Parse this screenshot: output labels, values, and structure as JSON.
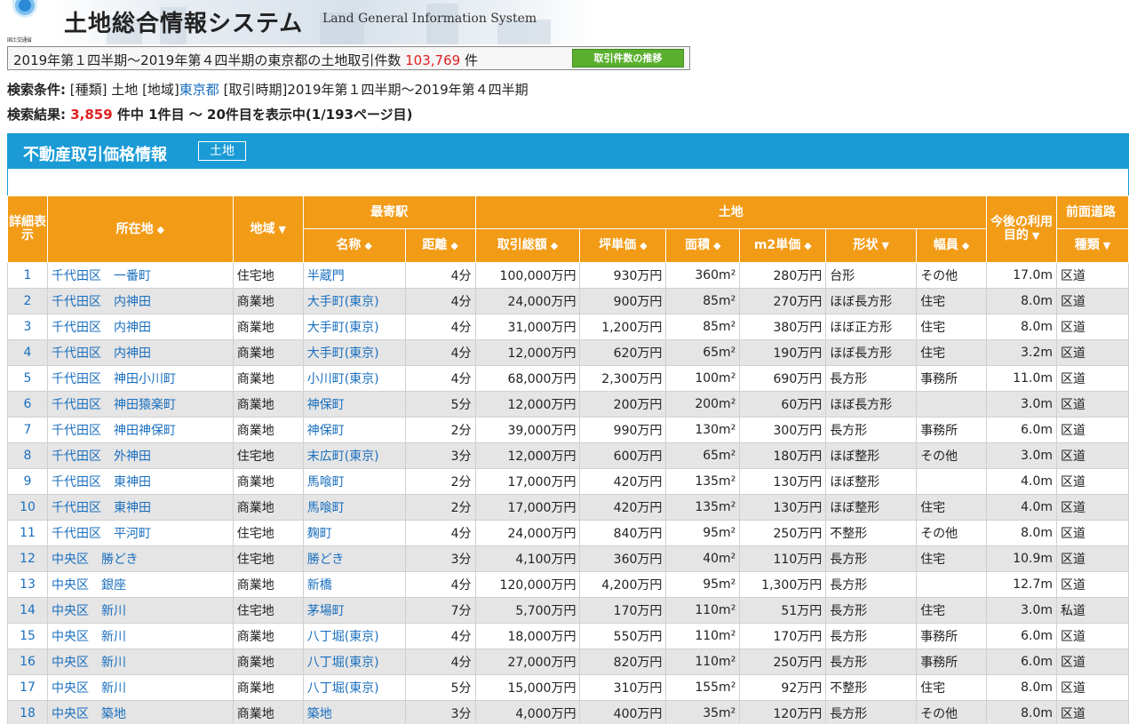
{
  "header": {
    "logo_text": "国土交通省",
    "title": "土地総合情報システム",
    "subtitle": "Land General Information System"
  },
  "summary": {
    "prefix": "2019年第１四半期～2019年第４四半期の東京都の土地取引件数",
    "count": "103,769",
    "suffix": "件",
    "trend_button": "取引件数の推移"
  },
  "conditions": {
    "label": "検索条件:",
    "type_label": "[種類]",
    "type_value": "土地",
    "region_label": "[地域]",
    "region_value": "東京都",
    "period_label": "[取引時期]",
    "period_value": "2019年第１四半期～2019年第４四半期"
  },
  "results": {
    "label": "検索結果:",
    "total": "3,859",
    "text": "件中 1件目 ～ 20件目を表示中(1/193ページ目)"
  },
  "panel": {
    "title": "不動産取引価格情報",
    "tag": "土地"
  },
  "table": {
    "headers": {
      "detail": "詳細表示",
      "location": "所在地",
      "area_type": "地域",
      "station_group": "最寄駅",
      "station_name": "名称",
      "distance": "距離",
      "land_group": "土地",
      "total_price": "取引総額",
      "tsubo_price": "坪単価",
      "area": "面積",
      "m2_price": "m2単価",
      "shape": "形状",
      "future_use": "今後の利用目的",
      "road_group": "前面道路",
      "road_width": "幅員",
      "road_type": "種類"
    },
    "icons": {
      "sort": "sort-updown-icon",
      "filter": "filter-down-icon"
    },
    "rows": [
      {
        "no": "1",
        "loc": "千代田区　一番町",
        "area_type": "住宅地",
        "station": "半蔵門",
        "dist": "4分",
        "total": "100,000万円",
        "tsubo": "930万円",
        "area": "360m²",
        "m2": "280万円",
        "shape": "台形",
        "use": "その他",
        "width": "17.0m",
        "road": "区道"
      },
      {
        "no": "2",
        "loc": "千代田区　内神田",
        "area_type": "商業地",
        "station": "大手町(東京)",
        "dist": "4分",
        "total": "24,000万円",
        "tsubo": "900万円",
        "area": "85m²",
        "m2": "270万円",
        "shape": "ほぼ長方形",
        "use": "住宅",
        "width": "8.0m",
        "road": "区道"
      },
      {
        "no": "3",
        "loc": "千代田区　内神田",
        "area_type": "商業地",
        "station": "大手町(東京)",
        "dist": "4分",
        "total": "31,000万円",
        "tsubo": "1,200万円",
        "area": "85m²",
        "m2": "380万円",
        "shape": "ほぼ正方形",
        "use": "住宅",
        "width": "8.0m",
        "road": "区道"
      },
      {
        "no": "4",
        "loc": "千代田区　内神田",
        "area_type": "商業地",
        "station": "大手町(東京)",
        "dist": "4分",
        "total": "12,000万円",
        "tsubo": "620万円",
        "area": "65m²",
        "m2": "190万円",
        "shape": "ほぼ長方形",
        "use": "住宅",
        "width": "3.2m",
        "road": "区道"
      },
      {
        "no": "5",
        "loc": "千代田区　神田小川町",
        "area_type": "商業地",
        "station": "小川町(東京)",
        "dist": "4分",
        "total": "68,000万円",
        "tsubo": "2,300万円",
        "area": "100m²",
        "m2": "690万円",
        "shape": "長方形",
        "use": "事務所",
        "width": "11.0m",
        "road": "区道"
      },
      {
        "no": "6",
        "loc": "千代田区　神田猿楽町",
        "area_type": "商業地",
        "station": "神保町",
        "dist": "5分",
        "total": "12,000万円",
        "tsubo": "200万円",
        "area": "200m²",
        "m2": "60万円",
        "shape": "ほぼ長方形",
        "use": "",
        "width": "3.0m",
        "road": "区道"
      },
      {
        "no": "7",
        "loc": "千代田区　神田神保町",
        "area_type": "商業地",
        "station": "神保町",
        "dist": "2分",
        "total": "39,000万円",
        "tsubo": "990万円",
        "area": "130m²",
        "m2": "300万円",
        "shape": "長方形",
        "use": "事務所",
        "width": "6.0m",
        "road": "区道"
      },
      {
        "no": "8",
        "loc": "千代田区　外神田",
        "area_type": "住宅地",
        "station": "末広町(東京)",
        "dist": "3分",
        "total": "12,000万円",
        "tsubo": "600万円",
        "area": "65m²",
        "m2": "180万円",
        "shape": "ほぼ整形",
        "use": "その他",
        "width": "3.0m",
        "road": "区道"
      },
      {
        "no": "9",
        "loc": "千代田区　東神田",
        "area_type": "商業地",
        "station": "馬喰町",
        "dist": "2分",
        "total": "17,000万円",
        "tsubo": "420万円",
        "area": "135m²",
        "m2": "130万円",
        "shape": "ほぼ整形",
        "use": "",
        "width": "4.0m",
        "road": "区道"
      },
      {
        "no": "10",
        "loc": "千代田区　東神田",
        "area_type": "商業地",
        "station": "馬喰町",
        "dist": "2分",
        "total": "17,000万円",
        "tsubo": "420万円",
        "area": "135m²",
        "m2": "130万円",
        "shape": "ほぼ整形",
        "use": "住宅",
        "width": "4.0m",
        "road": "区道"
      },
      {
        "no": "11",
        "loc": "千代田区　平河町",
        "area_type": "住宅地",
        "station": "麹町",
        "dist": "4分",
        "total": "24,000万円",
        "tsubo": "840万円",
        "area": "95m²",
        "m2": "250万円",
        "shape": "不整形",
        "use": "その他",
        "width": "8.0m",
        "road": "区道"
      },
      {
        "no": "12",
        "loc": "中央区　勝どき",
        "area_type": "住宅地",
        "station": "勝どき",
        "dist": "3分",
        "total": "4,100万円",
        "tsubo": "360万円",
        "area": "40m²",
        "m2": "110万円",
        "shape": "長方形",
        "use": "住宅",
        "width": "10.9m",
        "road": "区道"
      },
      {
        "no": "13",
        "loc": "中央区　銀座",
        "area_type": "商業地",
        "station": "新橋",
        "dist": "4分",
        "total": "120,000万円",
        "tsubo": "4,200万円",
        "area": "95m²",
        "m2": "1,300万円",
        "shape": "長方形",
        "use": "",
        "width": "12.7m",
        "road": "区道"
      },
      {
        "no": "14",
        "loc": "中央区　新川",
        "area_type": "住宅地",
        "station": "茅場町",
        "dist": "7分",
        "total": "5,700万円",
        "tsubo": "170万円",
        "area": "110m²",
        "m2": "51万円",
        "shape": "長方形",
        "use": "住宅",
        "width": "3.0m",
        "road": "私道"
      },
      {
        "no": "15",
        "loc": "中央区　新川",
        "area_type": "商業地",
        "station": "八丁堀(東京)",
        "dist": "4分",
        "total": "18,000万円",
        "tsubo": "550万円",
        "area": "110m²",
        "m2": "170万円",
        "shape": "長方形",
        "use": "事務所",
        "width": "6.0m",
        "road": "区道"
      },
      {
        "no": "16",
        "loc": "中央区　新川",
        "area_type": "商業地",
        "station": "八丁堀(東京)",
        "dist": "4分",
        "total": "27,000万円",
        "tsubo": "820万円",
        "area": "110m²",
        "m2": "250万円",
        "shape": "長方形",
        "use": "事務所",
        "width": "6.0m",
        "road": "区道"
      },
      {
        "no": "17",
        "loc": "中央区　新川",
        "area_type": "商業地",
        "station": "八丁堀(東京)",
        "dist": "5分",
        "total": "15,000万円",
        "tsubo": "310万円",
        "area": "155m²",
        "m2": "92万円",
        "shape": "不整形",
        "use": "住宅",
        "width": "8.0m",
        "road": "区道"
      },
      {
        "no": "18",
        "loc": "中央区　築地",
        "area_type": "商業地",
        "station": "築地",
        "dist": "3分",
        "total": "4,000万円",
        "tsubo": "400万円",
        "area": "35m²",
        "m2": "120万円",
        "shape": "長方形",
        "use": "その他",
        "width": "8.0m",
        "road": "区道"
      }
    ]
  }
}
